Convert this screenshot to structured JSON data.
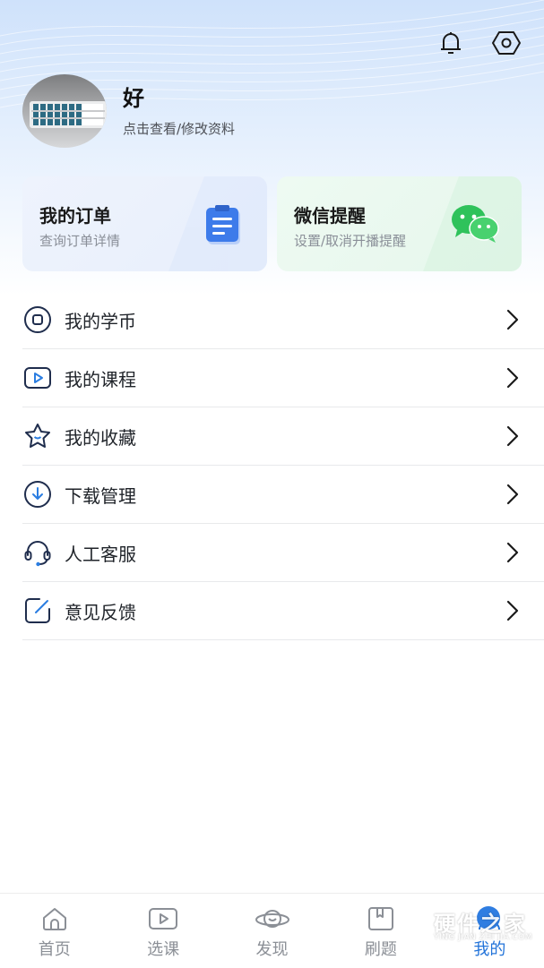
{
  "colors": {
    "accent": "#2273d9",
    "wechat_green": "#2fc25b",
    "order_blue": "#3d7bea"
  },
  "header": {
    "icons": [
      "bell-icon",
      "settings-hex-icon"
    ]
  },
  "profile": {
    "name": "好",
    "subtitle": "点击查看/修改资料"
  },
  "cards": [
    {
      "title": "我的订单",
      "subtitle": "查询订单详情",
      "icon": "clipboard-icon"
    },
    {
      "title": "微信提醒",
      "subtitle": "设置/取消开播提醒",
      "icon": "wechat-icon"
    }
  ],
  "menu": [
    {
      "label": "我的学币",
      "icon": "coin-icon"
    },
    {
      "label": "我的课程",
      "icon": "video-icon"
    },
    {
      "label": "我的收藏",
      "icon": "star-icon"
    },
    {
      "label": "下载管理",
      "icon": "download-icon"
    },
    {
      "label": "人工客服",
      "icon": "headset-icon"
    },
    {
      "label": "意见反馈",
      "icon": "edit-icon"
    }
  ],
  "tabs": [
    {
      "label": "首页",
      "icon": "home-icon"
    },
    {
      "label": "选课",
      "icon": "play-icon"
    },
    {
      "label": "发现",
      "icon": "planet-icon"
    },
    {
      "label": "刷题",
      "icon": "book-icon"
    },
    {
      "label": "我的",
      "icon": "user-icon",
      "active": true
    }
  ],
  "watermark": {
    "text": "硬件之家",
    "sub": "YING JIAN ZHI JIA.COM"
  }
}
